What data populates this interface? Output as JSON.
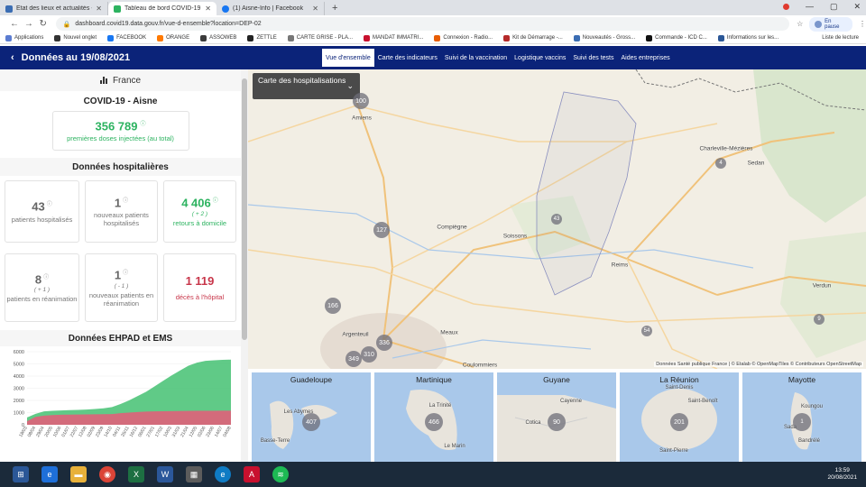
{
  "browser": {
    "tabs": [
      {
        "title": "Etat des lieux et actualités - Mini",
        "color": "#3b6db3"
      },
      {
        "title": "Tableau de bord COVID-19 Suivi",
        "color": "#2db360"
      },
      {
        "title": "(1) Aisne-Info | Facebook",
        "color": "#1877f2"
      }
    ],
    "url": "dashboard.covid19.data.gouv.fr/vue-d-ensemble?location=DEP-02",
    "pause_label": "En pause",
    "bookmarks": [
      "Applications",
      "Nouvel onglet",
      "FACEBOOK",
      "ORANGE",
      "ASSOWEB",
      "ZETTLE",
      "CARTE GRISE - PLA...",
      "MANDAT IMMATRI...",
      "Connexion - Radio...",
      "Kit de Démarrage -...",
      "Nouveautés - Gross...",
      "Commande - ICD C...",
      "Informations sur les..."
    ],
    "bookmark_right": "Liste de lecture"
  },
  "header": {
    "date_title": "Données au 19/08/2021",
    "tabs": [
      "Vue d'ensemble",
      "Carte des indicateurs",
      "Suivi de la vaccination",
      "Logistique vaccins",
      "Suivi des tests",
      "Aides entreprises"
    ],
    "active_tab": 0
  },
  "left": {
    "france_label": "France",
    "department": "COVID-19 - Aisne",
    "vaccination": {
      "value": "356 789",
      "label": "premières doses injectées (au total)"
    },
    "hospital_title": "Données hospitalières",
    "cards": [
      {
        "value": "43",
        "label": "patients hospitalisés",
        "delta": ""
      },
      {
        "value": "1",
        "label": "nouveaux patients hospitalisés",
        "delta": ""
      },
      {
        "value": "4 406",
        "label": "retours à domicile",
        "delta": "( + 2 )"
      },
      {
        "value": "8",
        "label": "patients en réanimation",
        "delta": "( + 1 )"
      },
      {
        "value": "1",
        "label": "nouveaux patients en réanimation",
        "delta": "( - 1 )"
      },
      {
        "value": "1 119",
        "label": "décès à l'hôpital",
        "delta": ""
      }
    ],
    "ehpad_title": "Données EHPAD et EMS"
  },
  "chart_data": {
    "type": "area",
    "title": "Données EHPAD et EMS",
    "ylim": [
      0,
      6000
    ],
    "yticks": [
      0,
      1000,
      2000,
      3000,
      4000,
      5000,
      6000
    ],
    "xticks": [
      "18/03",
      "08/04",
      "29/04",
      "20/05",
      "10/06",
      "01/07",
      "22/07",
      "12/08",
      "02/09",
      "23/09",
      "14/10",
      "04/11",
      "25/11",
      "16/12",
      "06/01",
      "27/01",
      "17/02",
      "10/03",
      "31/03",
      "21/04",
      "12/05",
      "02/06",
      "23/06",
      "14/07",
      "04/08"
    ],
    "series": [
      {
        "values": [
          300,
          650,
          750,
          800,
          820,
          830,
          840,
          850,
          860,
          870,
          880,
          950,
          1000,
          1050,
          1080,
          1100,
          1110,
          1120,
          1130,
          1140,
          1145,
          1150,
          1152,
          1155,
          1160
        ],
        "color": "#e0607a"
      },
      {
        "values": [
          600,
          900,
          1100,
          1150,
          1180,
          1200,
          1220,
          1250,
          1300,
          1350,
          1450,
          1700,
          2000,
          2350,
          2700,
          3150,
          3600,
          4050,
          4450,
          4850,
          5100,
          5250,
          5300,
          5330,
          5350
        ],
        "color": "#4fc47a"
      }
    ]
  },
  "map": {
    "selector_label": "Carte des hospitalisations",
    "attribution": "Données Santé publique France | © Etalab © OpenMapTiles © Contributeurs OpenStreetMap",
    "cities": [
      "Amiens",
      "Charleville-Mézières",
      "Sedan",
      "Compiègne",
      "Soissons",
      "Reims",
      "Verdun",
      "Argenteuil",
      "Meaux",
      "Coulommiers"
    ],
    "bubbles": [
      "100",
      "4",
      "43",
      "127",
      "166",
      "54",
      "9",
      "336",
      "310",
      "349"
    ]
  },
  "dom": [
    {
      "name": "Guadeloupe",
      "value": "407",
      "cities": [
        "Les Abymes",
        "Basse-Terre"
      ]
    },
    {
      "name": "Martinique",
      "value": "466",
      "cities": [
        "La Trinité",
        "Le Marin"
      ]
    },
    {
      "name": "Guyane",
      "value": "90",
      "cities": [
        "Cayenne",
        "Cotica"
      ]
    },
    {
      "name": "La Réunion",
      "value": "201",
      "cities": [
        "Saint-Denis",
        "Saint-Benoît",
        "Saint-Pierre"
      ]
    },
    {
      "name": "Mayotte",
      "value": "1",
      "cities": [
        "Koungou",
        "Sada",
        "Bandrélé"
      ]
    }
  ],
  "taskbar": {
    "time": "13:59",
    "date": "20/08/2021"
  }
}
